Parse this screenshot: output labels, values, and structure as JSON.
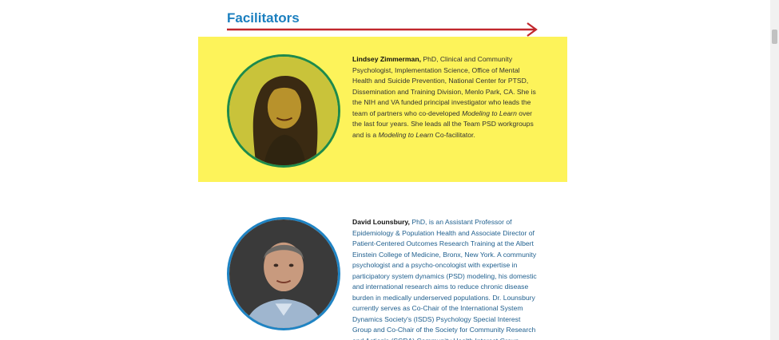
{
  "section": {
    "title": "Facilitators",
    "arrow_color": "#c1272d",
    "title_color": "#1b7fbf"
  },
  "facilitators": [
    {
      "name": "Lindsey Zimmerman,",
      "bio_part1": " PhD, Clinical and Community Psychologist, Implementation Science, Office of Mental Health and Suicide Prevention, National Center for PTSD, Dissemination and Training Division, Menlo Park, CA. She is the NIH and VA funded principal investigator who leads the team of partners who co-developed ",
      "bio_em1": "Modeling to Learn",
      "bio_part2": " over the last four years. She leads all the Team PSD workgroups and is a ",
      "bio_em2": "Modeling to Learn",
      "bio_part3": " Co-facilitator.",
      "background": "#fdf35a",
      "ring_color": "#1e8a4c"
    },
    {
      "name": "David Lounsbury,",
      "bio": " PhD, is an Assistant Professor of Epidemiology & Population Health and Associate Director of Patient-Centered Outcomes Research Training at the Albert Einstein College of Medicine, Bronx, New York. A community psychologist and a psycho-oncologist with expertise in participatory system dynamics (PSD) modeling, his domestic and international research aims to reduce chronic disease burden in medically underserved populations. Dr. Lounsbury currently serves as Co-Chair of the International System Dynamics Society's (ISDS) Psychology Special Interest Group and Co-Chair of the Society for Community Research and Action's (SCRA) Community Health Interest Group.",
      "ring_color": "#1f84c4"
    }
  ]
}
